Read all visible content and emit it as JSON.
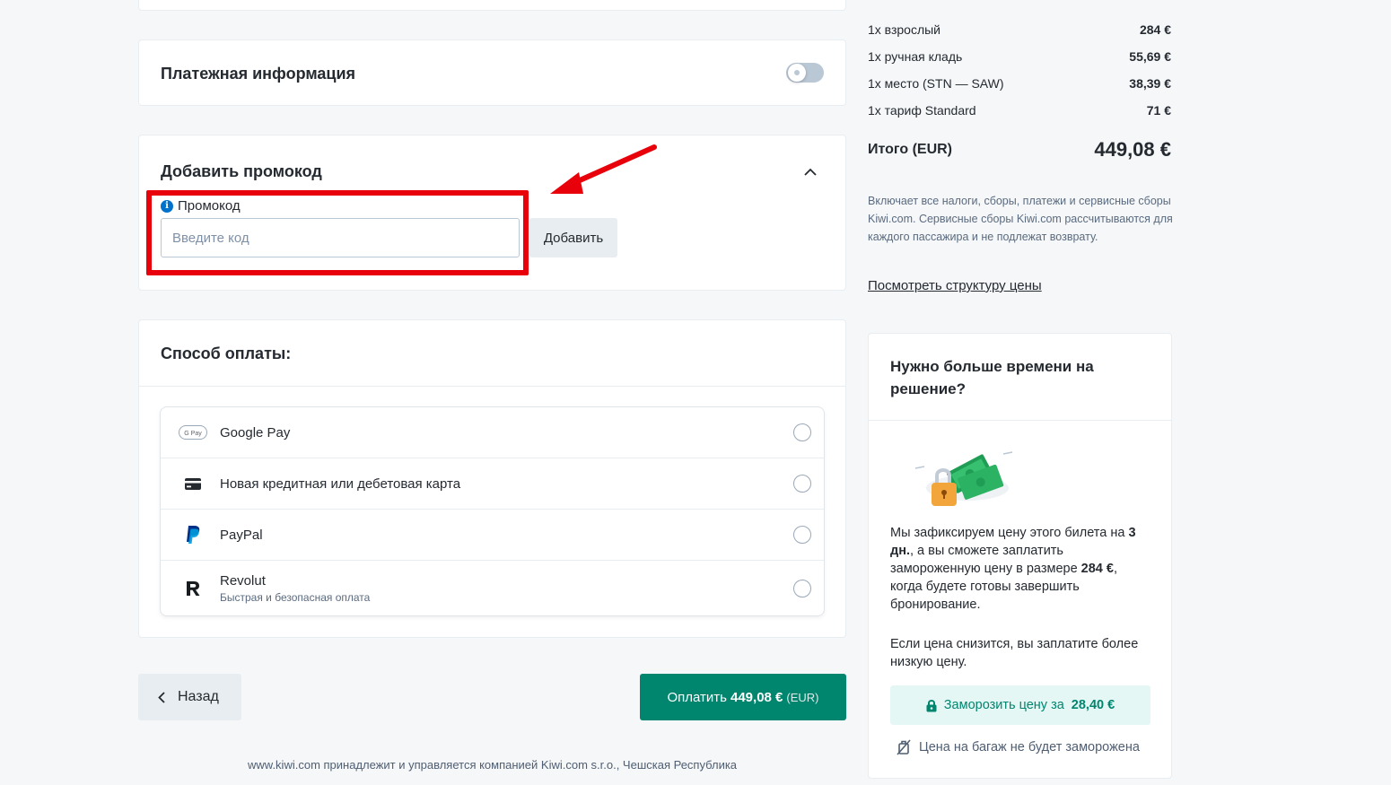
{
  "payment_info": {
    "title": "Платежная информация"
  },
  "promo": {
    "title": "Добавить промокод",
    "field_label": "Промокод",
    "placeholder": "Введите код",
    "add_button": "Добавить"
  },
  "payment_method": {
    "title": "Способ оплаты:",
    "options": [
      {
        "name": "Google Pay",
        "icon": "google-pay-icon"
      },
      {
        "name": "Новая кредитная или дебетовая карта",
        "icon": "credit-card-icon"
      },
      {
        "name": "PayPal",
        "icon": "paypal-icon"
      },
      {
        "name": "Revolut",
        "subtitle": "Быстрая и безопасная оплата",
        "icon": "revolut-icon"
      }
    ]
  },
  "nav": {
    "back": "Назад",
    "pay_prefix": "Оплатить",
    "pay_amount": "449,08 €",
    "pay_currency": "(EUR)"
  },
  "footer": "www.kiwi.com принадлежит и управляется компанией Kiwi.com s.r.o., Чешская Республика",
  "summary": {
    "items": [
      {
        "label": "1x взрослый",
        "value": "284 €"
      },
      {
        "label": "1x ручная кладь",
        "value": "55,69 €"
      },
      {
        "label": "1x место (STN — SAW)",
        "value": "38,39 €"
      },
      {
        "label": "1x тариф Standard",
        "value": "71 €"
      }
    ],
    "total_label": "Итого (EUR)",
    "total_value": "449,08 €",
    "taxes_note": "Включает все налоги, сборы, платежи и сервисные сборы Kiwi.com. Сервисные сборы Kiwi.com рассчитываются для каждого пассажира и не подлежат возврату.",
    "structure_link": "Посмотреть структуру цены"
  },
  "freeze": {
    "title": "Нужно больше времени на решение?",
    "text_1": "Мы зафиксируем цену этого билета на ",
    "days": "3 дн.",
    "text_2": ", а вы сможете заплатить замороженную цену в размере ",
    "frozen_price": "284 €",
    "text_3": ", когда будете готовы завершить бронирование.",
    "text_lower": "Если цена снизится, вы заплатите более низкую цену.",
    "button_prefix": "Заморозить цену за",
    "button_price": "28,40 €",
    "bag_note": "Цена на багаж не будет заморожена"
  },
  "colors": {
    "accent": "#00856f",
    "highlight": "#e8000a",
    "info": "#0172cb"
  }
}
